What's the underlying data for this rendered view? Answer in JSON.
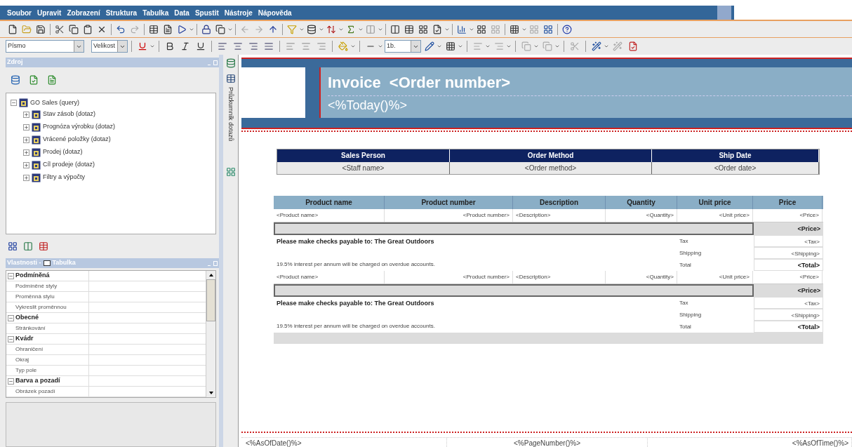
{
  "menu": [
    "Soubor",
    "Upravit",
    "Zobrazení",
    "Struktura",
    "Tabulka",
    "Data",
    "Spustit",
    "Nástroje",
    "Nápověda"
  ],
  "format_bar": {
    "font": "Písmo",
    "size": "Velikost",
    "line_width": "1b."
  },
  "source_panel": {
    "title": "Zdroj",
    "tree": [
      {
        "label": "GO Sales (query)",
        "expanded": true,
        "children": [
          {
            "label": "Stav zásob (dotaz)",
            "expanded": false
          },
          {
            "label": "Prognóza výrobku (dotaz)",
            "expanded": false
          },
          {
            "label": "Vrácené položky (dotaz)",
            "expanded": false
          },
          {
            "label": "Prodej (dotaz)",
            "expanded": false
          },
          {
            "label": "Cíl prodeje (dotaz)",
            "expanded": false
          },
          {
            "label": "Filtry a výpočty",
            "expanded": false
          }
        ]
      }
    ]
  },
  "side_tab": "Průzkumník dotazů",
  "properties_panel": {
    "title": "Vlastnosti -",
    "object": "Tabulka",
    "rows": [
      {
        "kind": "group",
        "label": "Podmíněná",
        "expanded": true
      },
      {
        "kind": "property",
        "label": "Podmíněné styly"
      },
      {
        "kind": "property",
        "label": "Proměnná stylu"
      },
      {
        "kind": "property",
        "label": "Vykreslit proměnnou"
      },
      {
        "kind": "group",
        "label": "Obecné",
        "expanded": true
      },
      {
        "kind": "property",
        "label": "Stránkování"
      },
      {
        "kind": "group",
        "label": "Kvádr",
        "expanded": true
      },
      {
        "kind": "property",
        "label": "Ohraničení"
      },
      {
        "kind": "property",
        "label": "Okraj"
      },
      {
        "kind": "property",
        "label": "Typ pole"
      },
      {
        "kind": "group",
        "label": "Barva a pozadí",
        "expanded": true
      },
      {
        "kind": "property",
        "label": "Obrázek pozadí"
      }
    ]
  },
  "report": {
    "title": "Invoice",
    "title_field": "<Order number>",
    "date": "<%Today()%>",
    "info_table": {
      "columns": [
        "Sales Person",
        "Order Method",
        "Ship Date"
      ],
      "row": [
        "<Staff name>",
        "<Order method>",
        "<Order date>"
      ]
    },
    "items_table": {
      "columns": [
        "Product name",
        "Product number",
        "Description",
        "Quantity",
        "Unit price",
        "Price"
      ],
      "sections": [
        {
          "detail": [
            "<Product name>",
            "<Product number>",
            "<Description>",
            "<Quantity>",
            "<Unit price>",
            "<Price>"
          ],
          "subtotal": "<Price>",
          "note_bold": "Please make checks payable to: The Great Outdoors",
          "note": "19.5% interest per annum will be charged on overdue accounts.",
          "summary": [
            {
              "label": "Tax",
              "value": "<Tax>",
              "bold": false
            },
            {
              "label": "Shipping",
              "value": "<Shipping>",
              "bold": false
            },
            {
              "label": "Total",
              "value": "<Total>",
              "bold": true
            }
          ]
        },
        {
          "detail": [
            "<Product name>",
            "<Product number>",
            "<Description>",
            "<Quantity>",
            "<Unit price>",
            "<Price>"
          ],
          "subtotal": "<Price>",
          "note_bold": "Please make checks payable to: The Great Outdoors",
          "note": "19.5% interest per annum will be charged on overdue accounts.",
          "summary": [
            {
              "label": "Tax",
              "value": "<Tax>",
              "bold": false
            },
            {
              "label": "Shipping",
              "value": "<Shipping>",
              "bold": false
            },
            {
              "label": "Total",
              "value": "<Total>",
              "bold": true
            }
          ]
        }
      ]
    },
    "footer": [
      "<%AsOfDate()%>",
      "<%PageNumber()%>",
      "<%AsOfTime()%>"
    ]
  }
}
